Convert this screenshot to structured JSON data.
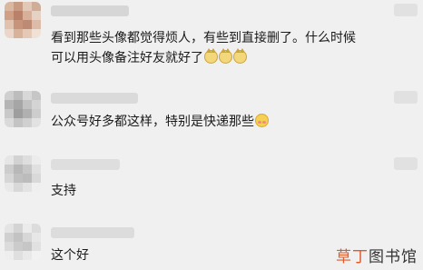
{
  "comments": [
    {
      "text_line1": "看到那些头像都觉得烦人，有些到直接删了。什么时候",
      "text_line2": "可以用头像备注好友就好了",
      "emojis": [
        "cat-face-emoji",
        "cat-face-emoji",
        "cat-face-emoji"
      ]
    },
    {
      "text": "公众号好多都这样，特别是快递那些",
      "emojis": [
        "shy-face-emoji"
      ]
    },
    {
      "text": "支持"
    },
    {
      "text": "这个好"
    }
  ],
  "watermark": {
    "part1": "草丁",
    "part2": "图书馆"
  }
}
